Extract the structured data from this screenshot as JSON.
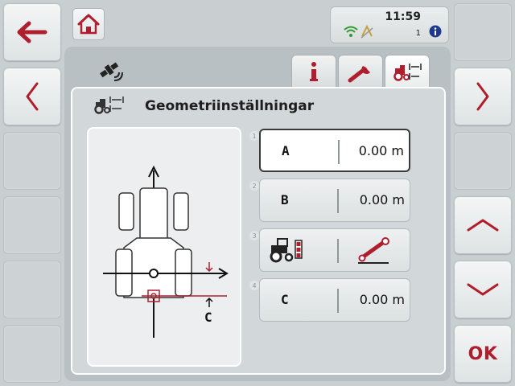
{
  "status": {
    "time": "11:59",
    "count": "1"
  },
  "panel": {
    "title": "Geometriinställningar"
  },
  "diagram": {
    "label_c": "C"
  },
  "params": [
    {
      "num": "1",
      "label": "A",
      "value": "0.00 m"
    },
    {
      "num": "2",
      "label": "B",
      "value": "0.00 m"
    },
    {
      "num": "3"
    },
    {
      "num": "4",
      "label": "C",
      "value": "0.00 m"
    }
  ],
  "softkeys": {
    "ok_label": "OK"
  },
  "colors": {
    "accent": "#b01e2d",
    "background": "#c9cfd1",
    "panel": "#d2d7d9"
  },
  "icons": {
    "back": "arrow-left-icon",
    "prev": "chevron-left-icon",
    "next": "chevron-right-icon",
    "up": "chevron-up-icon",
    "down": "chevron-down-icon",
    "home": "home-icon",
    "gps": "gps-icon",
    "info": "info-icon",
    "wrench": "wrench-icon",
    "tractor_geometry": "tractor-geometry-icon"
  }
}
